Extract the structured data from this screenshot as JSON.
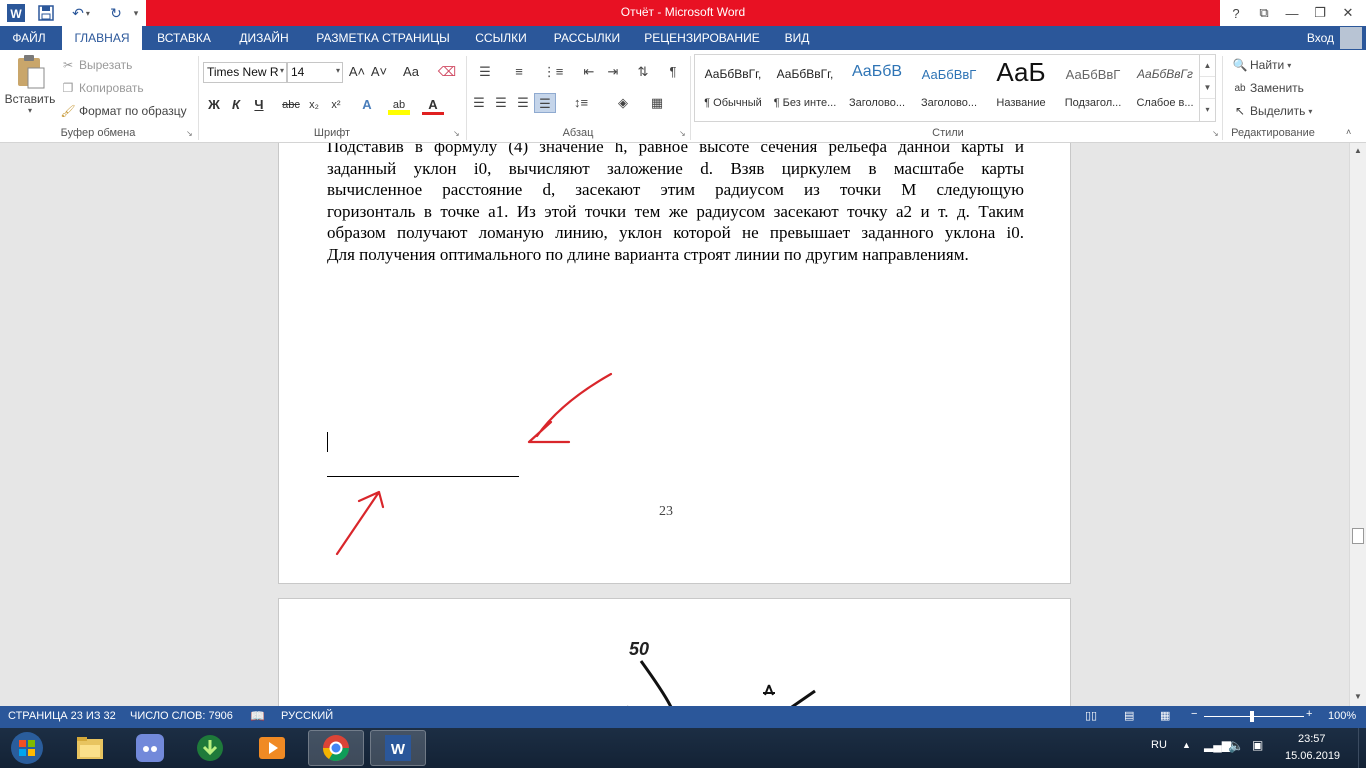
{
  "window": {
    "title": "Отчёт -  Microsoft Word",
    "help": "?",
    "controls": [
      "⧉",
      "—",
      "❐",
      "✕"
    ]
  },
  "tabs": [
    {
      "label": "ФАЙЛ"
    },
    {
      "label": "ГЛАВНАЯ"
    },
    {
      "label": "ВСТАВКА"
    },
    {
      "label": "ДИЗАЙН"
    },
    {
      "label": "РАЗМЕТКА СТРАНИЦЫ"
    },
    {
      "label": "ССЫЛКИ"
    },
    {
      "label": "РАССЫЛКИ"
    },
    {
      "label": "РЕЦЕНЗИРОВАНИЕ"
    },
    {
      "label": "ВИД"
    }
  ],
  "signin": "Вход",
  "clipboard": {
    "paste": "Вставить",
    "cut": "Вырезать",
    "copy": "Копировать",
    "format_painter": "Формат по образцу",
    "group": "Буфер обмена"
  },
  "font": {
    "name": "Times New R",
    "size": "14",
    "group": "Шрифт",
    "bold": "Ж",
    "italic": "К",
    "underline": "Ч",
    "strike": "abc",
    "sub": "x₂",
    "sup": "x²",
    "grow": "A˄",
    "shrink": "A˅",
    "case": "Aa",
    "text_effects": "A",
    "highlight": "ab",
    "font_color": "A"
  },
  "paragraph": {
    "group": "Абзац"
  },
  "styles": {
    "group": "Стили",
    "items": [
      {
        "sample": "АаБбВвГг,",
        "name": "¶ Обычный"
      },
      {
        "sample": "АаБбВвГг,",
        "name": "¶ Без инте..."
      },
      {
        "sample": "АаБбВ",
        "name": "Заголово..."
      },
      {
        "sample": "АаБбВвГ",
        "name": "Заголово..."
      },
      {
        "sample": "АаБ",
        "name": "Название"
      },
      {
        "sample": "АаБбВвГ",
        "name": "Подзагол..."
      },
      {
        "sample": "АаБбВвГг",
        "name": "Слабое в..."
      }
    ]
  },
  "editing": {
    "find": "Найти",
    "replace": "Заменить",
    "select": "Выделить",
    "group": "Редактирование"
  },
  "document": {
    "lines": [
      "Подставив в формулу (4) значение h, равное высоте сечения рельефа данной карты и",
      "заданный уклон i0, вычисляют заложение d. Взяв циркулем в масштабе карты",
      "вычисленное расстояние d, засекают этим радиусом из точки M следующую",
      "горизонталь в точке a1. Из этой точки тем же радиусом засекают точку a2 и т. д. Таким",
      "образом получают ломаную линию, уклон которой не превышает заданного уклона i0.",
      "Для получения оптимального по длине варианта строят линии по другим направлениям."
    ],
    "page_number": "23",
    "figure_label": "50"
  },
  "status": {
    "page": "СТРАНИЦА 23 ИЗ 32",
    "words": "ЧИСЛО СЛОВ: 7906",
    "language": "РУССКИЙ",
    "zoom": "100%"
  },
  "taskbar": {
    "lang": "RU",
    "time": "23:57",
    "date": "15.06.2019"
  },
  "colors": {
    "word_blue": "#2b579a",
    "title_red": "#e81123",
    "annotation_red": "#d9262b"
  }
}
